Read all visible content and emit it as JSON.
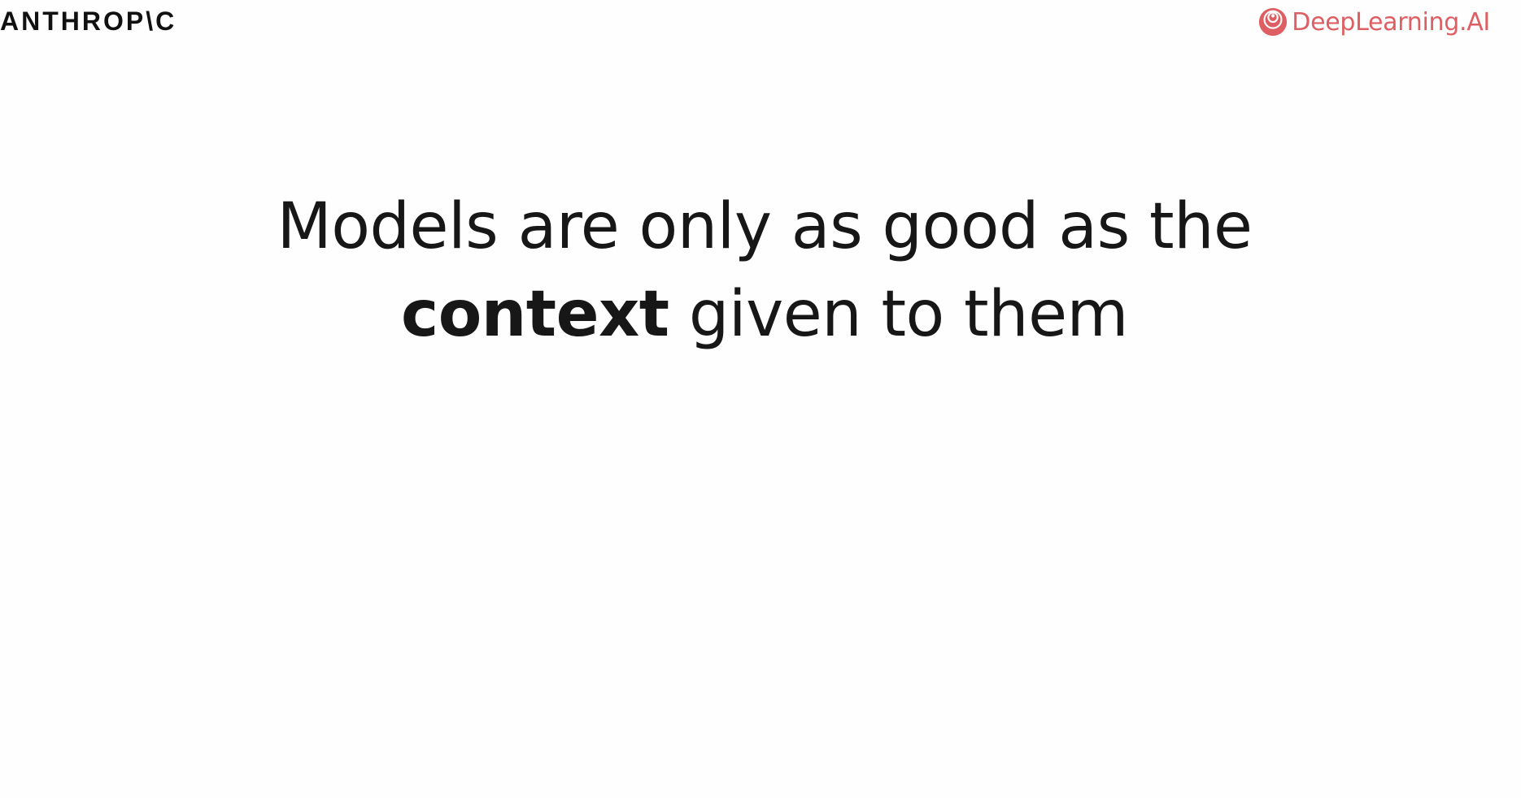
{
  "header": {
    "left_brand": "ANTHROP\\C",
    "right_brand": "DeepLearning.AI",
    "right_brand_icon": "deeplearning-logo-icon",
    "right_brand_color": "#dd5e63"
  },
  "headline": {
    "line1": "Models are only as good as the",
    "line2_bold": "context",
    "line2_rest": " given to them"
  }
}
